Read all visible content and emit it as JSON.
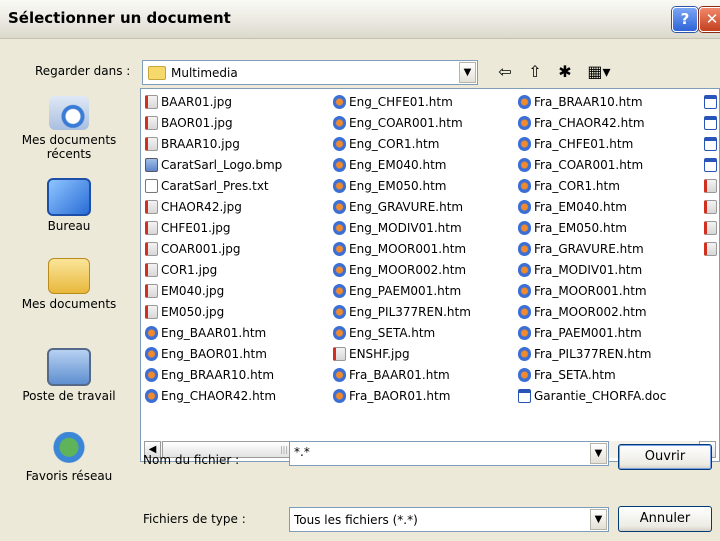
{
  "window": {
    "title": "Sélectionner un document",
    "help": "?",
    "close": "✕"
  },
  "lookin": {
    "label": "Regarder dans :",
    "value": "Multimedia"
  },
  "toolbar": {
    "back": "⇦",
    "up": "⇧",
    "newfolder": "✱",
    "views": "▦▾"
  },
  "places": [
    {
      "label": "Mes documents récents",
      "icon": "recent-documents-icon"
    },
    {
      "label": "Bureau",
      "icon": "desktop-icon"
    },
    {
      "label": "Mes documents",
      "icon": "my-documents-icon"
    },
    {
      "label": "Poste de travail",
      "icon": "my-computer-icon"
    },
    {
      "label": "Favoris réseau",
      "icon": "network-places-icon"
    }
  ],
  "files": {
    "col1": [
      "BAAR01.jpg",
      "BAOR01.jpg",
      "BRAAR10.jpg",
      "CaratSarl_Logo.bmp",
      "CaratSarl_Pres.txt",
      "CHAOR42.jpg",
      "CHFE01.jpg",
      "COAR001.jpg",
      "COR1.jpg",
      "EM040.jpg",
      "EM050.jpg",
      "Eng_BAAR01.htm",
      "Eng_BAOR01.htm",
      "Eng_BRAAR10.htm",
      "Eng_CHAOR42.htm"
    ],
    "col2": [
      "Eng_CHFE01.htm",
      "Eng_COAR001.htm",
      "Eng_COR1.htm",
      "Eng_EM040.htm",
      "Eng_EM050.htm",
      "Eng_GRAVURE.htm",
      "Eng_MODIV01.htm",
      "Eng_MOOR001.htm",
      "Eng_MOOR002.htm",
      "Eng_PAEM001.htm",
      "Eng_PIL377REN.htm",
      "Eng_SETA.htm",
      "ENSHF.jpg",
      "Fra_BAAR01.htm",
      "Fra_BAOR01.htm"
    ],
    "col3": [
      "Fra_BRAAR10.htm",
      "Fra_CHAOR42.htm",
      "Fra_CHFE01.htm",
      "Fra_COAR001.htm",
      "Fra_COR1.htm",
      "Fra_EM040.htm",
      "Fra_EM050.htm",
      "Fra_GRAVURE.htm",
      "Fra_MODIV01.htm",
      "Fra_MOOR001.htm",
      "Fra_MOOR002.htm",
      "Fra_PAEM001.htm",
      "Fra_PIL377REN.htm",
      "Fra_SETA.htm",
      "Garantie_CHORFA.doc"
    ]
  },
  "filename": {
    "label": "Nom du fichier :",
    "value": "*.*"
  },
  "filetype": {
    "label": "Fichiers de type :",
    "value": "Tous les fichiers (*.*)"
  },
  "buttons": {
    "open": "Ouvrir",
    "cancel": "Annuler"
  },
  "scroll": {
    "grip": "|||"
  }
}
